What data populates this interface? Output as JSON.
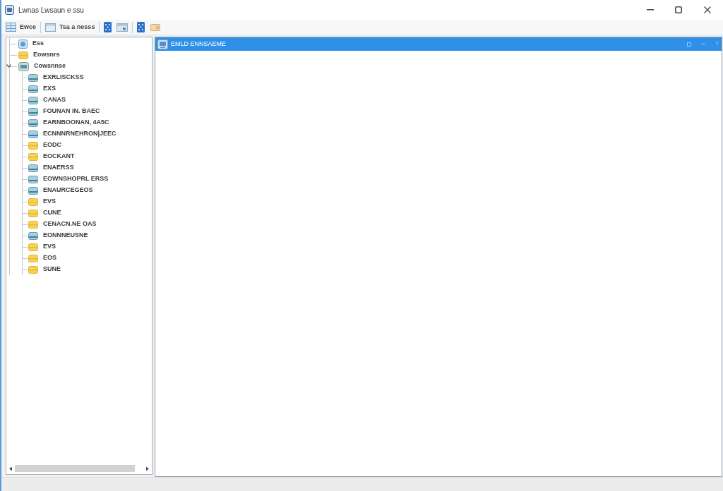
{
  "window": {
    "title": "Lwnas Lwsaun e ssu"
  },
  "toolbar": {
    "buttons": [
      {
        "label": "Ewce"
      },
      {
        "label": "Tsa a nesss"
      }
    ]
  },
  "tree": {
    "items": [
      {
        "label": "Ess",
        "kind": "computer"
      },
      {
        "label": "Eowsnrs",
        "kind": "folder"
      },
      {
        "label": "Cowsnnse",
        "kind": "network-drive",
        "expanded": true,
        "children": [
          {
            "label": "EXRLISCKSS",
            "kind": "drive"
          },
          {
            "label": "EXS",
            "kind": "drive"
          },
          {
            "label": "CANAS",
            "kind": "drive"
          },
          {
            "label": "FOUNAN IN. BAEC",
            "kind": "drive"
          },
          {
            "label": "EARNBOONAN, 4A5C",
            "kind": "drive"
          },
          {
            "label": "ECNNNRNEHRON|JEEC",
            "kind": "drive"
          },
          {
            "label": "EODC",
            "kind": "folder"
          },
          {
            "label": "EOCKANT",
            "kind": "folder"
          },
          {
            "label": "ENAERSS",
            "kind": "drive"
          },
          {
            "label": "EOWNSHOPRL ERSS",
            "kind": "drive"
          },
          {
            "label": "ENAURCEGEOS",
            "kind": "drive"
          },
          {
            "label": "EVS",
            "kind": "folder"
          },
          {
            "label": "CUNE",
            "kind": "folder"
          },
          {
            "label": "CENACN.NE OAS",
            "kind": "folder"
          },
          {
            "label": "EONNNEUSNE",
            "kind": "drive"
          },
          {
            "label": "EVS",
            "kind": "folder"
          },
          {
            "label": "EOS",
            "kind": "folder"
          },
          {
            "label": "SUNE",
            "kind": "folder"
          }
        ]
      }
    ]
  },
  "panel": {
    "title": "EMLD ENNSAEME"
  }
}
